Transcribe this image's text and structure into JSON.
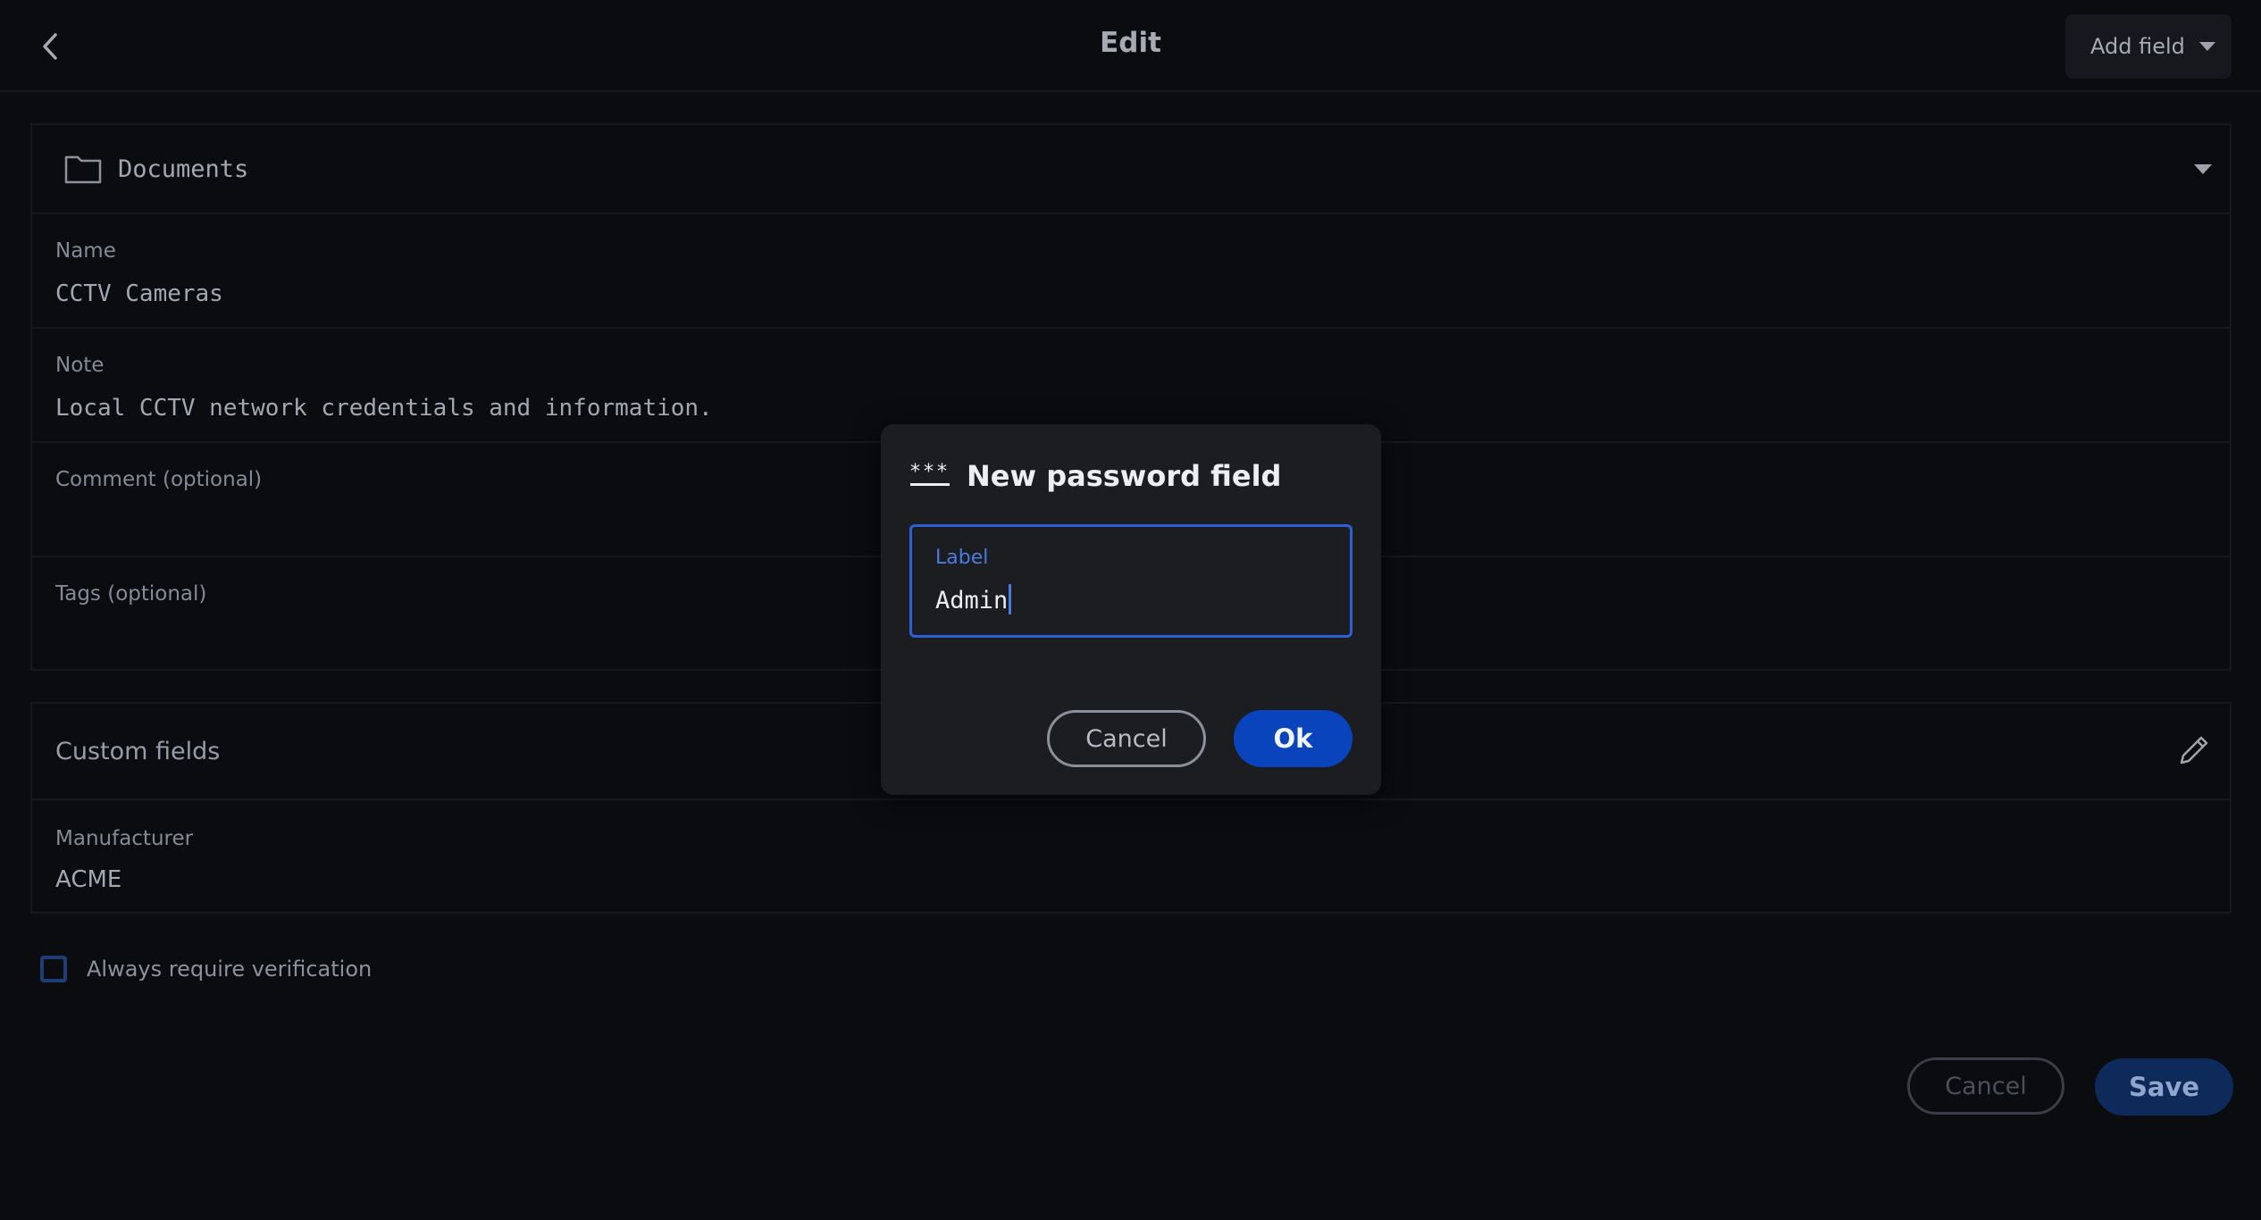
{
  "header": {
    "title": "Edit",
    "add_field_label": "Add field"
  },
  "folder": {
    "name": "Documents"
  },
  "fields": {
    "name": {
      "label": "Name",
      "value": "CCTV Cameras"
    },
    "note": {
      "label": "Note",
      "value": "Local CCTV network credentials and information."
    },
    "comment": {
      "label": "Comment (optional)",
      "value": ""
    },
    "tags": {
      "label": "Tags (optional)",
      "value": ""
    }
  },
  "custom": {
    "title": "Custom fields",
    "items": [
      {
        "label": "Manufacturer",
        "value": "ACME"
      }
    ]
  },
  "verification": {
    "label": "Always require verification",
    "checked": false
  },
  "footer": {
    "cancel_label": "Cancel",
    "save_label": "Save"
  },
  "dialog": {
    "title": "New password field",
    "icon": "password-stars-icon",
    "input_label": "Label",
    "input_value": "Admin",
    "cancel_label": "Cancel",
    "ok_label": "Ok"
  },
  "colors": {
    "accent": "#2d5fd6",
    "ok_button": "#0a44bd",
    "save_button": "#0e2a5b",
    "background": "#0b0c0f",
    "dialog_bg": "#1c1d21"
  }
}
